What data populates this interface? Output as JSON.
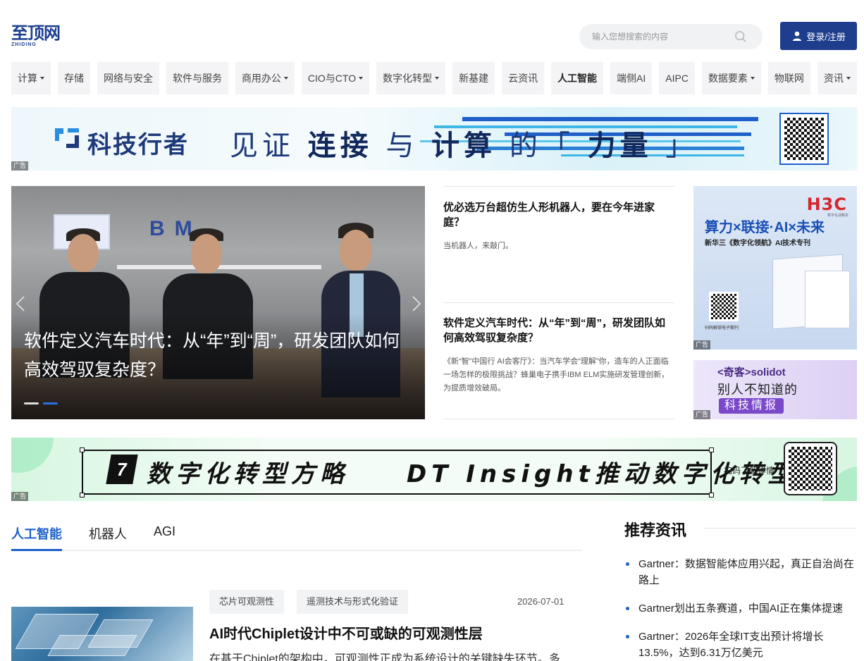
{
  "header": {
    "logo_text": "至顶网",
    "logo_sub": "ZHIDING",
    "search_placeholder": "输入您想搜索的内容",
    "login_label": "登录/注册"
  },
  "nav": [
    {
      "label": "计算",
      "dropdown": true,
      "bold": false
    },
    {
      "label": "存储",
      "dropdown": false,
      "bold": false
    },
    {
      "label": "网络与安全",
      "dropdown": false,
      "bold": false
    },
    {
      "label": "软件与服务",
      "dropdown": false,
      "bold": false
    },
    {
      "label": "商用办公",
      "dropdown": true,
      "bold": false
    },
    {
      "label": "CIO与CTO",
      "dropdown": true,
      "bold": false
    },
    {
      "label": "数字化转型",
      "dropdown": true,
      "bold": false
    },
    {
      "label": "新基建",
      "dropdown": false,
      "bold": false
    },
    {
      "label": "云资讯",
      "dropdown": false,
      "bold": false
    },
    {
      "label": "人工智能",
      "dropdown": false,
      "bold": true
    },
    {
      "label": "端侧AI",
      "dropdown": false,
      "bold": false
    },
    {
      "label": "AIPC",
      "dropdown": false,
      "bold": false
    },
    {
      "label": "数据要素",
      "dropdown": true,
      "bold": false
    },
    {
      "label": "物联网",
      "dropdown": false,
      "bold": false
    },
    {
      "label": "资讯",
      "dropdown": true,
      "bold": false
    }
  ],
  "ad_label": "广告",
  "banner1": {
    "brand": "科技行者",
    "slogan_1": "见证",
    "slogan_2": "连接",
    "slogan_3": "与",
    "slogan_4": "计算",
    "slogan_5": "的「",
    "slogan_6": "力量",
    "slogan_7": "」"
  },
  "hero": {
    "sign_text": "BM",
    "caption": "软件定义汽车时代：从“年”到“周”，研发团队如何高效驾驭复杂度？",
    "slide_count": 2,
    "active_slide": 1
  },
  "mid_articles": [
    {
      "title": "优必选万台超仿生人形机器人，要在今年进家庭？",
      "excerpt": "当机器人，来敲门。"
    },
    {
      "title": "软件定义汽车时代：从“年”到“周”，研发团队如何高效驾驭复杂度？",
      "excerpt": "《新“智”中国行 AI会客厅》：当汽车学会“理解”你，造车的人正面临一场怎样的极限挑战？蜂巢电子携手IBM ELM实施研发管理创新，为提质增效破局。"
    }
  ],
  "ad_h3c": {
    "brand": "H3C",
    "brand_sub": "数字化战略本",
    "headline": "算力×联接·AI×未来",
    "subline": "新华三《数字化领航》AI技术专刊",
    "footer": "扫码解锁电子期刊"
  },
  "ad_solidot": {
    "line1": "<奇客>solidot",
    "line2": "别人不知道的",
    "line3": "科技情报"
  },
  "banner2": {
    "badge": "7",
    "text": "数字化转型方略　　DT Insight推动数字化转型",
    "scan_label": "扫码了解详情"
  },
  "tabs": [
    "人工智能",
    "机器人",
    "AGI"
  ],
  "active_tab": 0,
  "article": {
    "tags": [
      "芯片可观测性",
      "遥测技术与形式化验证"
    ],
    "date": "2026-07-01",
    "title": "AI时代Chiplet设计中不可或缺的可观测性层",
    "excerpt": "在基于Chiplet的架构中，可观测性正成为系统设计的关键缺失环节。多"
  },
  "recommend": {
    "title": "推荐资讯",
    "items": [
      "Gartner：数据智能体应用兴起，真正自治尚在路上",
      "Gartner划出五条赛道，中国AI正在集体提速",
      "Gartner：2026年全球IT支出预计将增长13.5%，达到6.31万亿美元"
    ]
  },
  "colors": {
    "brand_blue": "#1e3d8c",
    "accent_blue": "#1c5fc8",
    "h3c_red": "#d6262d"
  },
  "icons": [
    "search-icon",
    "user-icon",
    "chevron-left-icon",
    "chevron-right-icon",
    "qr-code-icon"
  ]
}
